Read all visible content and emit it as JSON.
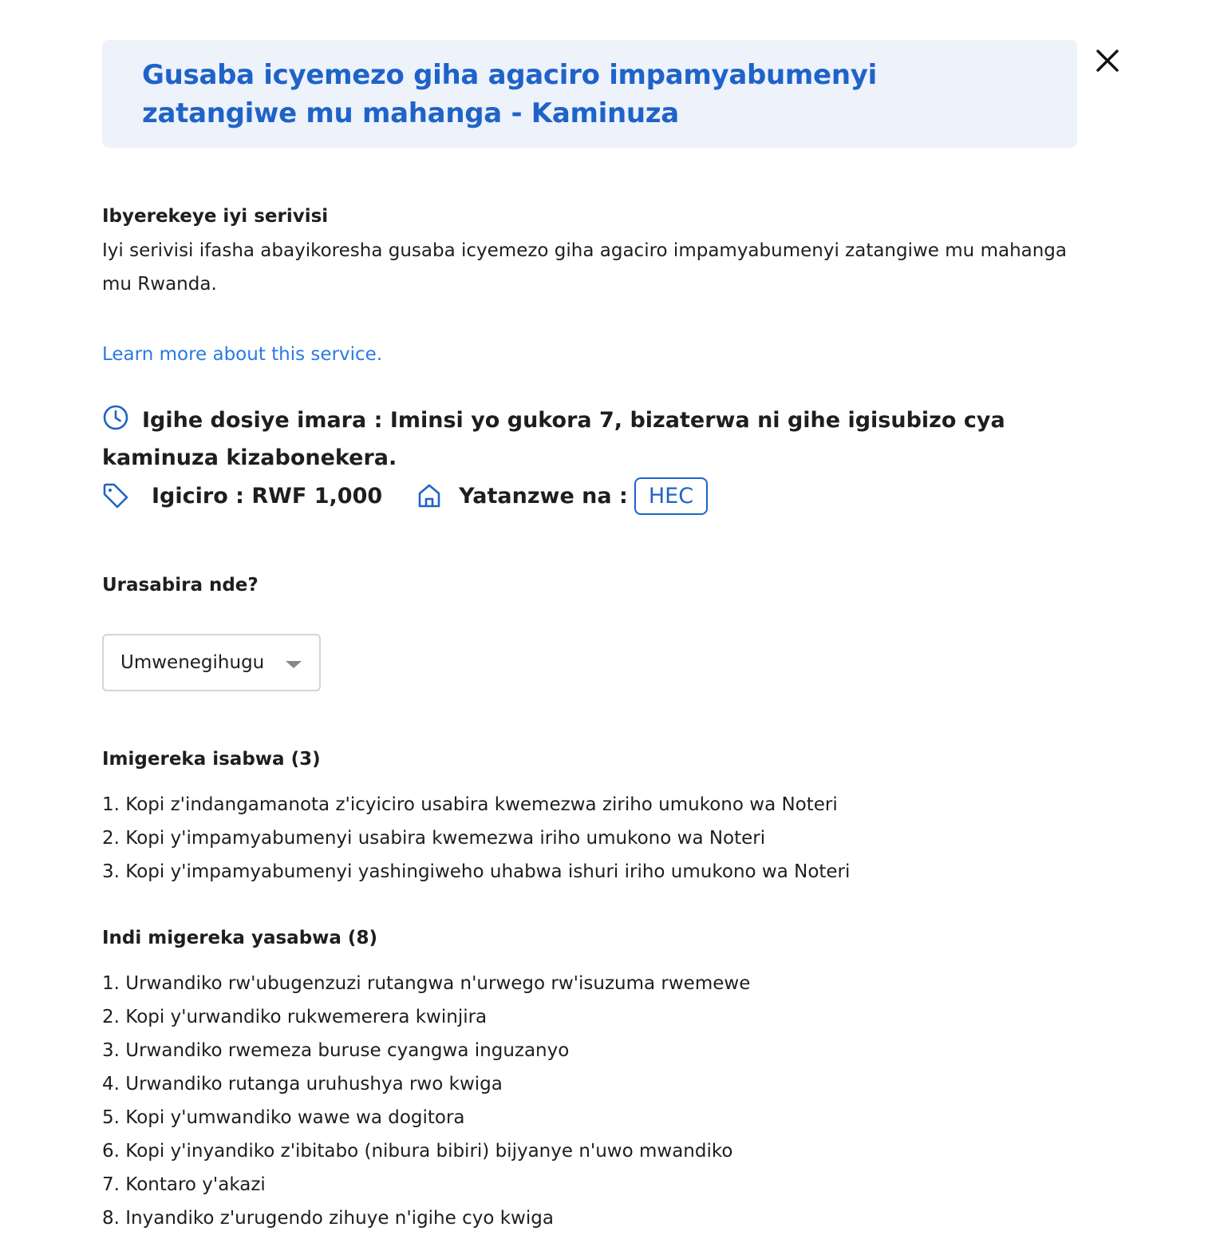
{
  "header": {
    "title": "Gusaba icyemezo giha agaciro impamyabumenyi zatangiwe mu mahanga - Kaminuza",
    "close_icon": "close-icon"
  },
  "about": {
    "heading": "Ibyerekeye iyi serivisi",
    "text": "Iyi serivisi ifasha abayikoresha gusaba icyemezo giha agaciro impamyabumenyi zatangiwe mu mahanga mu Rwanda.",
    "learn_more": "Learn more about this service."
  },
  "details": {
    "duration": "Igihe dosiye imara : Iminsi yo gukora 7, bizaterwa ni gihe igisubizo cya kaminuza kizabonekera.",
    "price": "Igiciro : RWF 1,000",
    "provider_label": "Yatanzwe na :",
    "provider_badge": "HEC",
    "icons": [
      "clock-icon",
      "price-tag-icon",
      "institution-icon"
    ],
    "accent_color": "#1f63c8"
  },
  "applicant": {
    "heading": "Urasabira nde?",
    "selected": "Umwenegihugu"
  },
  "required_docs": {
    "heading": "Imigereka isabwa (3)",
    "items": [
      "1. Kopi z'indangamanota z'icyiciro usabira kwemezwa ziriho umukono wa Noteri",
      "2. Kopi y'impamyabumenyi usabira kwemezwa iriho umukono wa Noteri",
      "3. Kopi y'impamyabumenyi yashingiweho uhabwa ishuri iriho umukono wa Noteri"
    ]
  },
  "other_docs": {
    "heading": "Indi migereka yasabwa (8)",
    "items": [
      "1. Urwandiko rw'ubugenzuzi rutangwa n'urwego rw'isuzuma rwemewe",
      "2. Kopi y'urwandiko rukwemerera kwinjira",
      "3. Urwandiko rwemeza buruse cyangwa inguzanyo",
      "4. Urwandiko rutanga uruhushya rwo kwiga",
      "5. Kopi y'umwandiko wawe wa dogitora",
      "6. Kopi y'inyandiko z'ibitabo (nibura bibiri) bijyanye n'uwo mwandiko",
      "7. Kontaro y'akazi",
      "8. Inyandiko z'urugendo zihuye n'igihe cyo kwiga"
    ]
  }
}
